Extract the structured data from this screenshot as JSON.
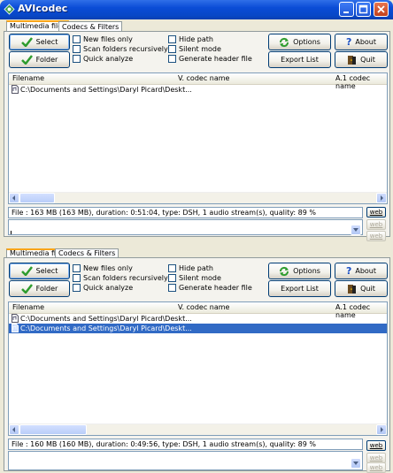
{
  "window": {
    "title": "AVIcodec",
    "icon": "avicodec-app-icon",
    "controls": [
      "minimize",
      "maximize",
      "close"
    ]
  },
  "tabs": [
    {
      "label": "Multimedia files",
      "active": true
    },
    {
      "label": "Codecs & Filters",
      "active": false
    }
  ],
  "buttons": {
    "select": "Select",
    "folder": "Folder",
    "options": "Options",
    "export": "Export List",
    "about": "About",
    "quit": "Quit"
  },
  "checkboxes": {
    "new_files_only": "New files only",
    "scan_recursively": "Scan folders recursively",
    "quick_analyze": "Quick analyze",
    "hide_path": "Hide path",
    "silent_mode": "Silent mode",
    "generate_header": "Generate header file"
  },
  "columns": [
    "Filename",
    "V. codec name",
    "A.1 codec name"
  ],
  "views": [
    {
      "rows": [
        "C:\\Documents and Settings\\Daryl Picard\\Deskt..."
      ],
      "selected_row": -1,
      "info": "File   : 163 MB (163 MB),  duration: 0:51:04,  type: DSH,  1 audio stream(s),  quality: 89 %"
    },
    {
      "rows": [
        "C:\\Documents and Settings\\Daryl Picard\\Deskt...",
        "C:\\Documents and Settings\\Daryl Picard\\Deskt..."
      ],
      "selected_row": 1,
      "info": "File   : 160 MB (160 MB),  duration: 0:49:56,  type: DSH,  1 audio stream(s),  quality: 89 %"
    }
  ],
  "web_label": "web",
  "colors": {
    "titlebar": "#0a4cd6",
    "selection": "#316ac5",
    "tab_highlight": "#f9a51a"
  }
}
